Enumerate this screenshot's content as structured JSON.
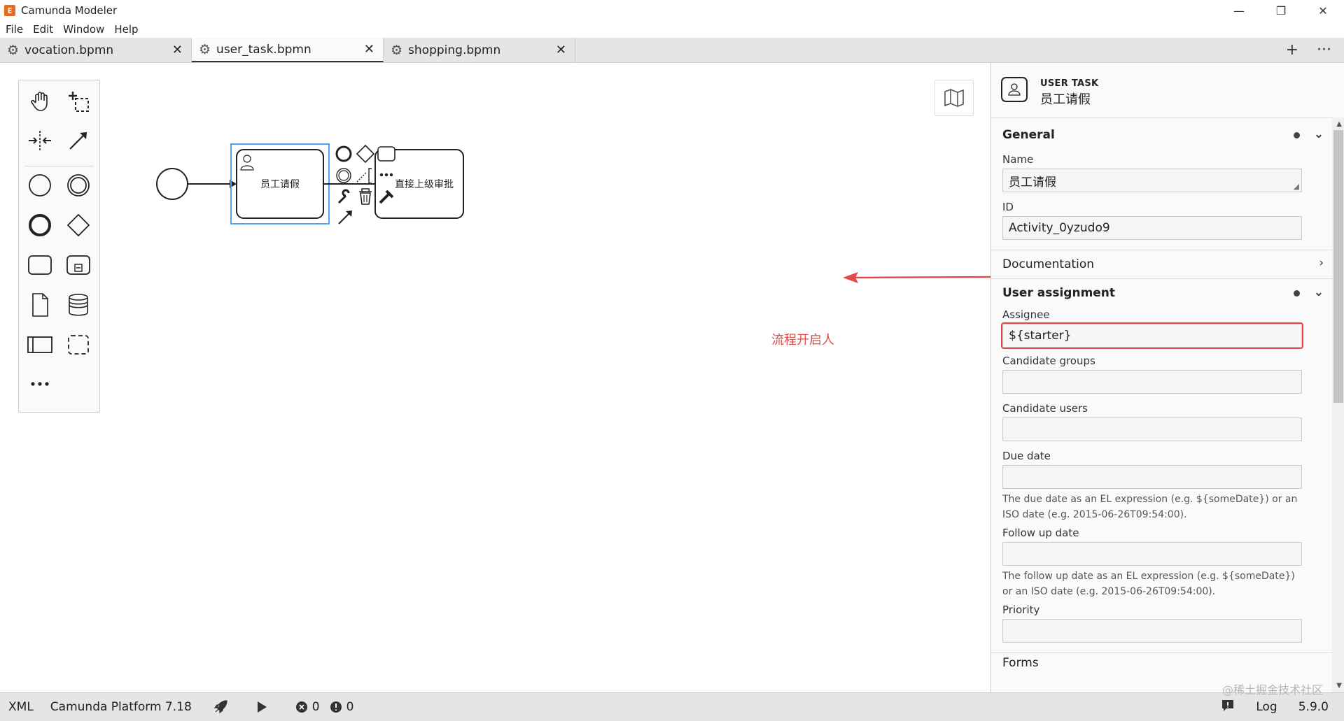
{
  "window": {
    "title": "Camunda Modeler",
    "app_icon_glyph": "E",
    "controls": {
      "minimize": "—",
      "restore": "❐",
      "close": "✕"
    }
  },
  "menu": [
    "File",
    "Edit",
    "Window",
    "Help"
  ],
  "tabs": [
    {
      "label": "vocation.bpmn",
      "active": false
    },
    {
      "label": "user_task.bpmn",
      "active": true
    },
    {
      "label": "shopping.bpmn",
      "active": false
    }
  ],
  "tab_actions": {
    "add": "+",
    "more": "···"
  },
  "diagram": {
    "task1_label": "员工请假",
    "task2_label": "直接上级审批"
  },
  "annotation": {
    "text": "流程开启人",
    "color": "#e04a4a"
  },
  "panel": {
    "element_type": "USER TASK",
    "element_name": "员工请假",
    "general": {
      "title": "General",
      "name_label": "Name",
      "name_value": "员工请假",
      "id_label": "ID",
      "id_value": "Activity_0yzudo9"
    },
    "documentation": {
      "title": "Documentation"
    },
    "user_assignment": {
      "title": "User assignment",
      "assignee_label": "Assignee",
      "assignee_value": "${starter}",
      "candidate_groups_label": "Candidate groups",
      "candidate_users_label": "Candidate users",
      "due_date_label": "Due date",
      "due_date_desc": "The due date as an EL expression (e.g. ${someDate}) or an ISO date (e.g. 2015-06-26T09:54:00).",
      "follow_up_label": "Follow up date",
      "follow_up_desc": "The follow up date as an EL expression (e.g. ${someDate}) or an ISO date (e.g. 2015-06-26T09:54:00).",
      "priority_label": "Priority"
    },
    "forms": {
      "title": "Forms"
    }
  },
  "statusbar": {
    "xml": "XML",
    "platform": "Camunda Platform 7.18",
    "errors": "0",
    "warnings": "0",
    "log": "Log",
    "version": "5.9.0",
    "watermark": "@稀土掘金技术社区"
  },
  "colors": {
    "accent": "#e56c1c",
    "selection": "#4da3ff",
    "highlight": "#e04a4a"
  }
}
